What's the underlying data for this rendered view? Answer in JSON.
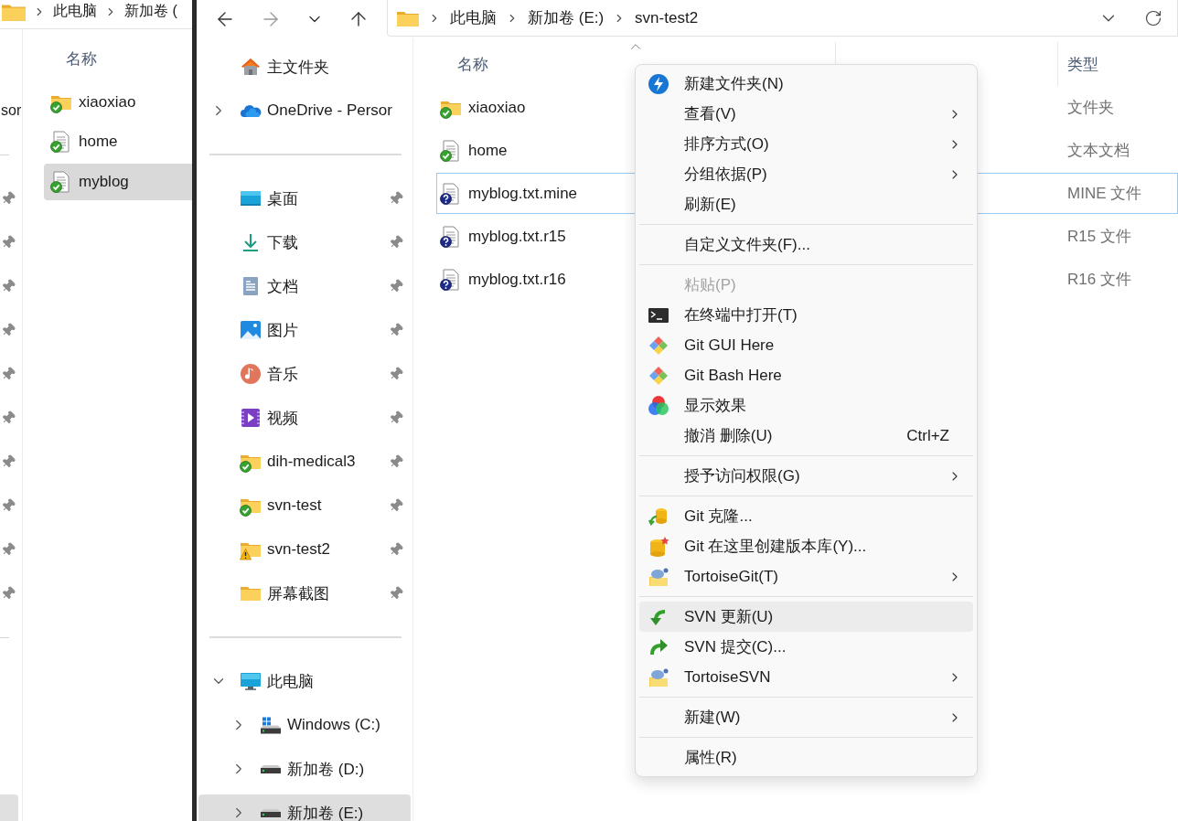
{
  "back_window": {
    "breadcrumbs": [
      "此电脑",
      "新加卷 ("
    ],
    "sidebar": {
      "sections": [
        [
          {
            "selected": false
          },
          {
            "label": "sor",
            "selected": false
          }
        ],
        [
          {
            "pinned": true,
            "selected": false
          },
          {
            "pinned": true,
            "selected": false
          },
          {
            "pinned": true,
            "selected": false
          },
          {
            "pinned": true,
            "selected": false
          },
          {
            "pinned": true,
            "selected": false
          },
          {
            "pinned": true,
            "selected": false
          },
          {
            "pinned": true,
            "selected": false
          },
          {
            "pinned": true,
            "selected": false
          },
          {
            "pinned": true,
            "selected": false
          },
          {
            "pinned": true,
            "selected": false
          }
        ],
        [
          {
            "pinned": false,
            "selected": false
          },
          {
            "pinned": false,
            "selected": false
          },
          {
            "pinned": false,
            "selected": false
          },
          {
            "pinned": false,
            "selected": true
          }
        ]
      ]
    },
    "column": "名称",
    "files": [
      {
        "name": "xiaoxiao",
        "kind": "folder_normal",
        "selected": false
      },
      {
        "name": "home",
        "kind": "document_normal",
        "selected": false
      },
      {
        "name": "myblog",
        "kind": "document_normal",
        "selected": true
      }
    ]
  },
  "window": {
    "breadcrumbs": [
      "此电脑",
      "新加卷 (E:)",
      "svn-test2"
    ],
    "sidebar": {
      "sections": [
        [
          {
            "label": "主文件夹",
            "kind": "home",
            "pinned": false,
            "selected": false
          },
          {
            "label": "OneDrive - Persor",
            "kind": "cloud",
            "expanded": false,
            "pinned": false,
            "selected": false
          }
        ],
        [
          {
            "label": "桌面",
            "kind": "desktop",
            "pinned": true,
            "selected": false
          },
          {
            "label": "下载",
            "kind": "download",
            "pinned": true,
            "selected": false
          },
          {
            "label": "文档",
            "kind": "documents",
            "pinned": true,
            "selected": false
          },
          {
            "label": "图片",
            "kind": "pictures",
            "pinned": true,
            "selected": false
          },
          {
            "label": "音乐",
            "kind": "music",
            "pinned": true,
            "selected": false
          },
          {
            "label": "视频",
            "kind": "videos",
            "pinned": true,
            "selected": false
          },
          {
            "label": "dih-medical3",
            "kind": "folder_normal",
            "pinned": true,
            "selected": false
          },
          {
            "label": "svn-test",
            "kind": "folder_normal",
            "pinned": true,
            "selected": false
          },
          {
            "label": "svn-test2",
            "kind": "folder_conflicted",
            "pinned": true,
            "selected": false
          },
          {
            "label": "屏幕截图",
            "kind": "folder",
            "pinned": true,
            "selected": false
          }
        ],
        [
          {
            "label": "此电脑",
            "kind": "pc",
            "expanded": true,
            "pinned": false,
            "selected": false,
            "children": [
              {
                "label": "Windows (C:)",
                "kind": "system-drive",
                "expanded": false,
                "pinned": false,
                "selected": false
              },
              {
                "label": "新加卷 (D:)",
                "kind": "drive",
                "expanded": false,
                "pinned": false,
                "selected": false
              },
              {
                "label": "新加卷 (E:)",
                "kind": "drive",
                "expanded": false,
                "pinned": false,
                "selected": true
              }
            ]
          }
        ]
      ]
    },
    "columns": [
      {
        "label": "名称",
        "sorted": true
      },
      {
        "sorted": false
      },
      {
        "label": "类型",
        "sorted": false
      }
    ],
    "files": [
      {
        "name": "xiaoxiao",
        "kind": "folder_normal",
        "type": "文件夹",
        "selected": false
      },
      {
        "name": "home",
        "kind": "document_normal",
        "type": "文本文档",
        "selected": false
      },
      {
        "name": "myblog.txt.mine",
        "kind": "document_unversioned",
        "type": "MINE 文件",
        "selected": true
      },
      {
        "name": "myblog.txt.r15",
        "kind": "document_unversioned",
        "type": "R15 文件",
        "selected": false
      },
      {
        "name": "myblog.txt.r16",
        "kind": "document_unversioned",
        "type": "R16 文件",
        "selected": false
      }
    ]
  },
  "context_menu": {
    "sections": [
      [
        {
          "label": "新建文件夹(N)",
          "kind": "new-folder",
          "submenu": false,
          "disabled": false,
          "highlighted": false
        },
        {
          "label": "查看(V)",
          "submenu": true,
          "disabled": false,
          "highlighted": false
        },
        {
          "label": "排序方式(O)",
          "submenu": true,
          "disabled": false,
          "highlighted": false
        },
        {
          "label": "分组依据(P)",
          "submenu": true,
          "disabled": false,
          "highlighted": false
        },
        {
          "label": "刷新(E)",
          "submenu": false,
          "disabled": false,
          "highlighted": false
        }
      ],
      [
        {
          "label": "自定义文件夹(F)...",
          "submenu": false,
          "disabled": false,
          "highlighted": false
        }
      ],
      [
        {
          "label": "粘贴(P)",
          "submenu": false,
          "disabled": true,
          "highlighted": false
        },
        {
          "label": "在终端中打开(T)",
          "kind": "terminal",
          "submenu": false,
          "disabled": false,
          "highlighted": false
        },
        {
          "label": "Git GUI Here",
          "kind": "git",
          "submenu": false,
          "disabled": false,
          "highlighted": false
        },
        {
          "label": "Git Bash Here",
          "kind": "git",
          "submenu": false,
          "disabled": false,
          "highlighted": false
        },
        {
          "label": "显示效果",
          "kind": "color",
          "submenu": false,
          "disabled": false,
          "highlighted": false
        },
        {
          "label": "撤消 删除(U)",
          "shortcut": "Ctrl+Z",
          "submenu": false,
          "disabled": false,
          "highlighted": false
        }
      ],
      [
        {
          "label": "授予访问权限(G)",
          "submenu": true,
          "disabled": false,
          "highlighted": false
        }
      ],
      [
        {
          "label": "Git 克隆...",
          "kind": "clone",
          "submenu": false,
          "disabled": false,
          "highlighted": false
        },
        {
          "label": "Git 在这里创建版本库(Y)...",
          "kind": "repo",
          "submenu": false,
          "disabled": false,
          "highlighted": false
        },
        {
          "label": "TortoiseGit(T)",
          "kind": "tortoise",
          "submenu": true,
          "disabled": false,
          "highlighted": false
        }
      ],
      [
        {
          "label": "SVN 更新(U)",
          "kind": "update",
          "submenu": false,
          "disabled": false,
          "highlighted": true
        },
        {
          "label": "SVN 提交(C)...",
          "kind": "commit",
          "submenu": false,
          "disabled": false,
          "highlighted": false
        },
        {
          "label": "TortoiseSVN",
          "kind": "tortoise",
          "submenu": true,
          "disabled": false,
          "highlighted": false
        }
      ],
      [
        {
          "label": "新建(W)",
          "submenu": true,
          "disabled": false,
          "highlighted": false
        }
      ],
      [
        {
          "label": "属性(R)",
          "submenu": false,
          "disabled": false,
          "highlighted": false
        }
      ]
    ]
  }
}
